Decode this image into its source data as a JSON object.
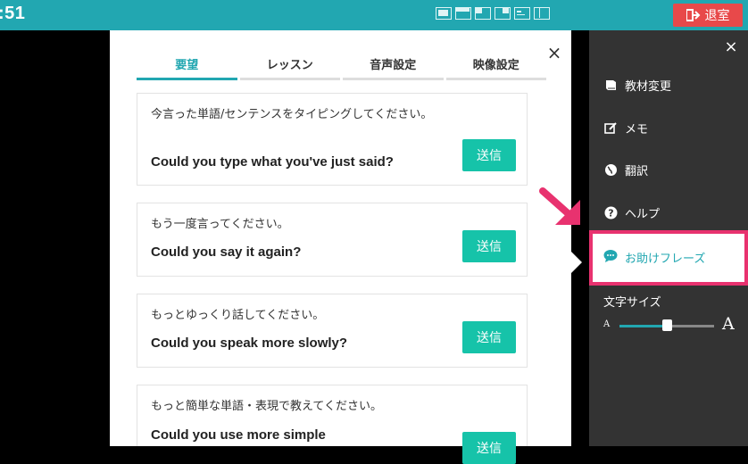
{
  "header": {
    "clock": ":51",
    "exit_label": "退室",
    "layout_icons": [
      "layout-full-icon",
      "layout-split-top-icon",
      "layout-grid-icon",
      "layout-cards-icon",
      "layout-text-icon",
      "layout-columns-icon"
    ]
  },
  "modal": {
    "tabs": [
      {
        "label": "要望",
        "active": true
      },
      {
        "label": "レッスン",
        "active": false
      },
      {
        "label": "音声設定",
        "active": false
      },
      {
        "label": "映像設定",
        "active": false
      }
    ],
    "phrases": [
      {
        "jp": "今言った単語/センテンスをタイピングしてください。",
        "en": "Could you type what you've just said?",
        "send": "送信"
      },
      {
        "jp": "もう一度言ってください。",
        "en": "Could you say it again?",
        "send": "送信"
      },
      {
        "jp": "もっとゆっくり話してください。",
        "en": "Could you speak more slowly?",
        "send": "送信"
      },
      {
        "jp": "もっと簡単な単語・表現で教えてください。",
        "en": "Could you use more simple",
        "send": "送信"
      }
    ]
  },
  "sidebar": {
    "items": [
      {
        "label": "教材変更",
        "icon": "book-icon"
      },
      {
        "label": "メモ",
        "icon": "edit-icon"
      },
      {
        "label": "翻訳",
        "icon": "globe-icon"
      },
      {
        "label": "ヘルプ",
        "icon": "help-icon"
      }
    ],
    "active_item": {
      "label": "お助けフレーズ",
      "icon": "chat-bubble-icon"
    },
    "font_size": {
      "label": "文字サイズ",
      "small": "A",
      "large": "A",
      "level": 0.5
    },
    "colors": {
      "accent": "#22a7b1",
      "highlight": "#e8326f",
      "send": "#16c3a9",
      "exit": "#e8494a"
    }
  }
}
